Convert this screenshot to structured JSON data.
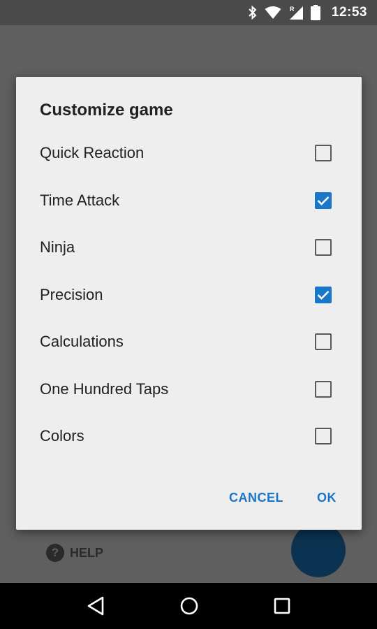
{
  "status_bar": {
    "time": "12:53",
    "icons": [
      "bluetooth-icon",
      "wifi-icon",
      "signal-roaming-icon",
      "battery-icon"
    ]
  },
  "background": {
    "help_label": "HELP"
  },
  "dialog": {
    "title": "Customize game",
    "options": [
      {
        "label": "Quick Reaction",
        "checked": false
      },
      {
        "label": "Time Attack",
        "checked": true
      },
      {
        "label": "Ninja",
        "checked": false
      },
      {
        "label": "Precision",
        "checked": true
      },
      {
        "label": "Calculations",
        "checked": false
      },
      {
        "label": "One Hundred Taps",
        "checked": false
      },
      {
        "label": "Colors",
        "checked": false
      }
    ],
    "cancel_label": "CANCEL",
    "ok_label": "OK"
  },
  "nav_bar": {
    "icons": [
      "back-icon",
      "home-icon",
      "recents-icon"
    ]
  },
  "colors": {
    "accent": "#1976c9",
    "fab": "#0b3250"
  }
}
